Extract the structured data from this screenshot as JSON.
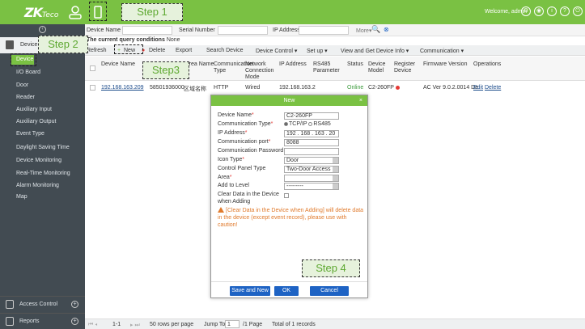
{
  "app": {
    "logo": "ZK",
    "logo_suffix": "Teco",
    "welcome": "Welcome, admin"
  },
  "sidebar": {
    "module": "Device",
    "items": [
      "Device",
      "I/O Board",
      "Door",
      "Reader",
      "Auxiliary Input",
      "Auxiliary Output",
      "Event Type",
      "Daylight Saving Time",
      "Device Monitoring",
      "Real-Time Monitoring",
      "Alarm Monitoring",
      "Map"
    ],
    "bottom": [
      "Access Control",
      "Reports"
    ]
  },
  "filter": {
    "device_name": "Device Name",
    "serial_number": "Serial Number",
    "ip_address": "IP Address",
    "more": "More▾"
  },
  "query": {
    "label": "The current query conditions",
    "value": "None"
  },
  "toolbar": {
    "refresh": "Refresh",
    "new": "New",
    "delete": "Delete",
    "export": "Export",
    "search_device": "Search Device",
    "device_control": "Device Control ▾",
    "setup": "Set up ▾",
    "view_get": "View and Get Device Info ▾",
    "communication": "Communication ▾"
  },
  "table": {
    "headers": [
      "Device Name",
      "Serial Number",
      "Area Name",
      "Communication Type",
      "Network Connection Mode",
      "IP Address",
      "RS485 Parameter",
      "Status",
      "Device Model",
      "Register Device",
      "Firmware Version",
      "Operations"
    ],
    "row": {
      "ip": "192.168.163.209",
      "serial": "58501936000",
      "area": "区域名称",
      "comm": "HTTP",
      "network": "Wired",
      "ip_short": "192.168.163.2",
      "status": "Online",
      "model": "C2-260FP",
      "firmware": "AC Ver 9.0.2.0014 De",
      "edit": "Edit",
      "delete": "Delete"
    }
  },
  "pager": {
    "range": "1-1",
    "per_page": "50 rows per page",
    "jump_label": "Jump To",
    "page": "1",
    "pages": "/1 Page",
    "total": "Total of 1 records"
  },
  "dialog": {
    "title": "New",
    "fields": {
      "device_name": {
        "label": "Device Name",
        "value": "C2-260FP"
      },
      "comm_type": {
        "label": "Communication Type",
        "opt1": "TCP/IP",
        "opt2": "RS485"
      },
      "ip": {
        "label": "IP Address",
        "value": "192 . 168 . 163 . 20"
      },
      "port": {
        "label": "Communication port",
        "value": "8088"
      },
      "password": {
        "label": "Communication Password",
        "value": ""
      },
      "icon_type": {
        "label": "Icon Type",
        "value": "Door"
      },
      "panel_type": {
        "label": "Control Panel Type",
        "value": "Two-Door Access"
      },
      "area": {
        "label": "Area",
        "value": ""
      },
      "level": {
        "label": "Add to Level",
        "value": "---------"
      },
      "clear": {
        "label1": "Clear Data in the Device",
        "label2": "when Adding"
      }
    },
    "warning": "[Clear Data in the Device when Adding] will delete data in the device (except event record), please use with caution!",
    "buttons": {
      "save_new": "Save and New",
      "ok": "OK",
      "cancel": "Cancel"
    }
  },
  "steps": [
    "Step 1",
    "Step 2",
    "Step3",
    "Step 4"
  ],
  "colors": {
    "brand": "#7ac143",
    "sidebar": "#424b52",
    "button": "#1e63c4",
    "warning": "#e07a2c"
  }
}
